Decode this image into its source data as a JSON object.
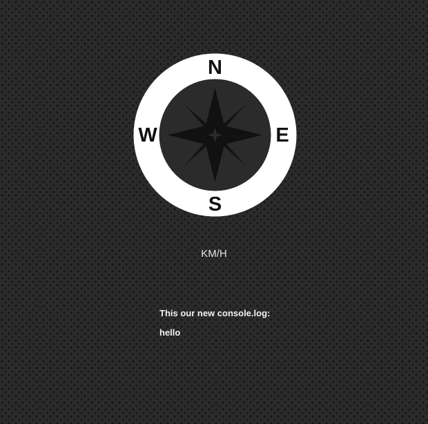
{
  "compass": {
    "north": "N",
    "east": "E",
    "south": "S",
    "west": "W"
  },
  "speed": {
    "unit": "KM/H"
  },
  "console": {
    "label": "This our new console.log:",
    "value": "hello"
  },
  "colors": {
    "background": "#2b2b2b",
    "ring": "#ffffff",
    "rose": "#111111",
    "text": "#f2f2f2"
  },
  "icons": {
    "compass_rose": "compass-rose-icon"
  }
}
